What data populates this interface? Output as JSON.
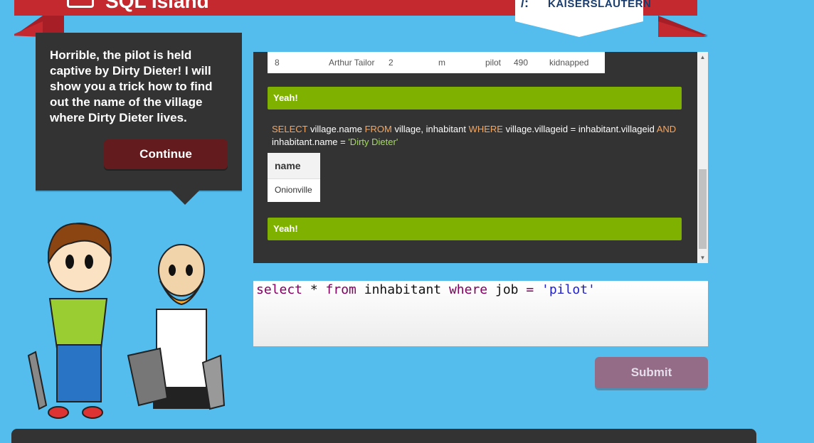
{
  "header": {
    "title": "SQL Island",
    "university_label": "KAISERSLAUTERN",
    "university_mark": "/:"
  },
  "dialog": {
    "text": "Horrible, the pilot is held captive by Dirty Dieter! I will show you a trick how to find out the name of the village where Dirty Dieter lives.",
    "continue_label": "Continue"
  },
  "output": {
    "top_row": [
      "8",
      "Arthur Tailor",
      "2",
      "m",
      "pilot",
      "490",
      "kidnapped"
    ],
    "yeah1": "Yeah!",
    "query": {
      "select_kw": "SELECT",
      "select_cols": "village.name",
      "from_kw": "FROM",
      "tables": "village, inhabitant",
      "where_kw": "WHERE",
      "cond1": "village.villageid = inhabitant.villageid",
      "and_kw": "AND",
      "cond2": "inhabitant.name = ",
      "cond2_value": "'Dirty Dieter'"
    },
    "result_header": "name",
    "result_value": "Onionville",
    "yeah2": "Yeah!"
  },
  "editor": {
    "kw_select": "select",
    "star": " * ",
    "kw_from": "from",
    "table": " inhabitant ",
    "kw_where": "where",
    "col": " job ",
    "op": "=",
    "value": " 'pilot'"
  },
  "submit_label": "Submit",
  "colors": {
    "ribbon": "#c3292f",
    "background": "#54bdee",
    "success": "#7eb100",
    "submit": "#956c87"
  }
}
